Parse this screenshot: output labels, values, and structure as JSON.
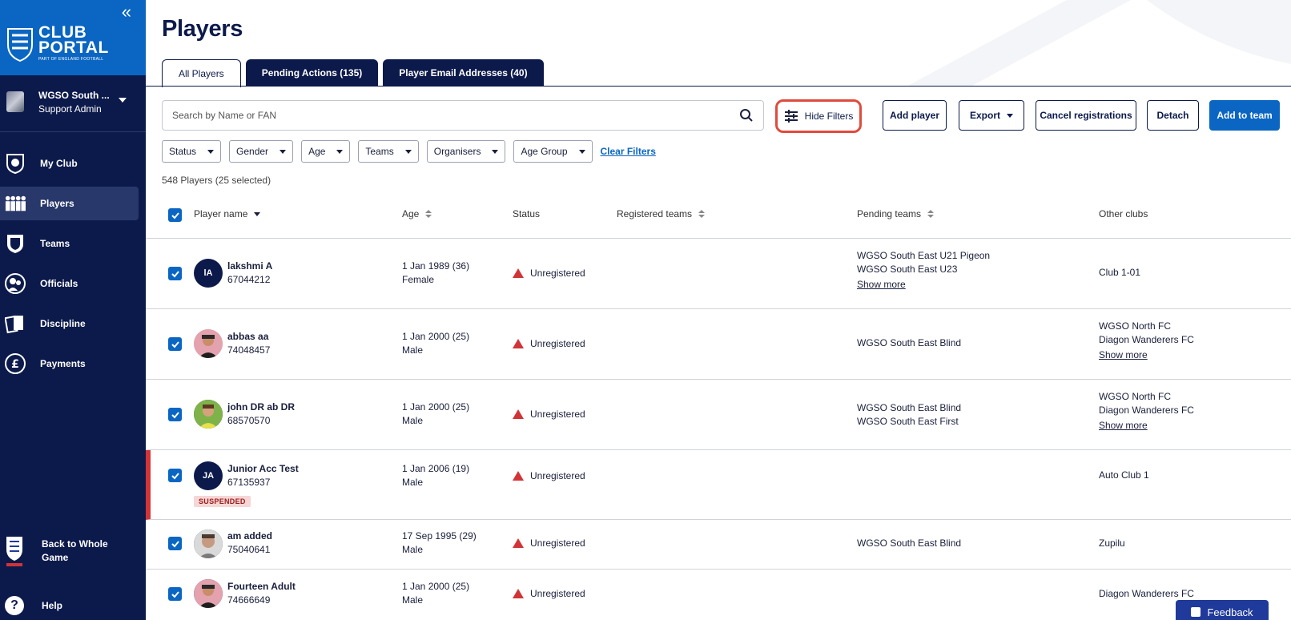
{
  "sidebar": {
    "logo": {
      "line1": "CLUB",
      "line2": "PORTAL",
      "line3": "PART OF ENGLAND FOOTBALL"
    },
    "collapse_icon": "«",
    "account": {
      "name": "WGSO South ...",
      "role": "Support Admin"
    },
    "nav": [
      {
        "label": "My Club",
        "icon": "shield-ball-icon"
      },
      {
        "label": "Players",
        "icon": "players-icon"
      },
      {
        "label": "Teams",
        "icon": "kit-icon"
      },
      {
        "label": "Officials",
        "icon": "whistle-icon"
      },
      {
        "label": "Discipline",
        "icon": "cards-icon"
      },
      {
        "label": "Payments",
        "icon": "pound-icon"
      }
    ],
    "back_label_1": "Back to Whole",
    "back_label_2": "Game",
    "help_label": "Help",
    "help_icon": "?"
  },
  "page": {
    "title": "Players",
    "tabs": [
      "All Players",
      "Pending Actions (135)",
      "Player Email Addresses (40)"
    ],
    "search_placeholder": "Search by Name or FAN",
    "buttons": {
      "hide_filters": "Hide Filters",
      "add_player": "Add player",
      "export": "Export",
      "cancel_registrations": "Cancel registrations",
      "detach": "Detach",
      "add_to_team": "Add to team"
    },
    "filters": [
      "Status",
      "Gender",
      "Age",
      "Teams",
      "Organisers",
      "Age Group"
    ],
    "clear_filters": "Clear Filters",
    "count": "548 Players (25 selected)"
  },
  "table": {
    "headers": {
      "name": "Player name",
      "age": "Age",
      "status": "Status",
      "registered": "Registered teams",
      "pending": "Pending teams",
      "other": "Other clubs"
    },
    "rows": [
      {
        "name": "lakshmi A",
        "fan": "67044212",
        "initials": "lA",
        "age": "1 Jan 1989 (36)",
        "gender": "Female",
        "status": "Unregistered",
        "pending": [
          "WGSO South East U21 Pigeon",
          "WGSO South East U23"
        ],
        "pending_more": "Show more",
        "other": [
          "Club 1-01"
        ],
        "other_more": ""
      },
      {
        "name": "abbas aa",
        "fan": "74048457",
        "initials": "",
        "age": "1 Jan 2000 (25)",
        "gender": "Male",
        "status": "Unregistered",
        "pending": [
          "WGSO South East Blind"
        ],
        "pending_more": "",
        "other": [
          "WGSO North FC",
          "Diagon Wanderers FC"
        ],
        "other_more": "Show more"
      },
      {
        "name": "john DR ab DR",
        "fan": "68570570",
        "initials": "",
        "age": "1 Jan 2000 (25)",
        "gender": "Male",
        "status": "Unregistered",
        "pending": [
          "WGSO South East Blind",
          "WGSO South East First"
        ],
        "pending_more": "",
        "other": [
          "WGSO North FC",
          "Diagon Wanderers FC"
        ],
        "other_more": "Show more"
      },
      {
        "name": "Junior Acc Test",
        "fan": "67135937",
        "initials": "JA",
        "age": "1 Jan 2006 (19)",
        "gender": "Male",
        "status": "Unregistered",
        "pending": [],
        "pending_more": "",
        "other": [
          "Auto Club 1"
        ],
        "other_more": "",
        "badge": "SUSPENDED"
      },
      {
        "name": "am added",
        "fan": "75040641",
        "initials": "",
        "age": "17 Sep 1995 (29)",
        "gender": "Male",
        "status": "Unregistered",
        "pending": [
          "WGSO South East Blind"
        ],
        "pending_more": "",
        "other": [
          "Zupilu"
        ],
        "other_more": ""
      },
      {
        "name": "Fourteen Adult",
        "fan": "74666649",
        "initials": "",
        "age": "1 Jan 2000 (25)",
        "gender": "Male",
        "status": "Unregistered",
        "pending": [],
        "pending_more": "",
        "other": [
          "Diagon Wanderers FC"
        ],
        "other_more": ""
      }
    ]
  },
  "feedback": "Feedback",
  "colors": {
    "navy": "#0c1a4b",
    "blue": "#0a66c2",
    "red": "#d13438",
    "highlight": "#e04b3d"
  }
}
